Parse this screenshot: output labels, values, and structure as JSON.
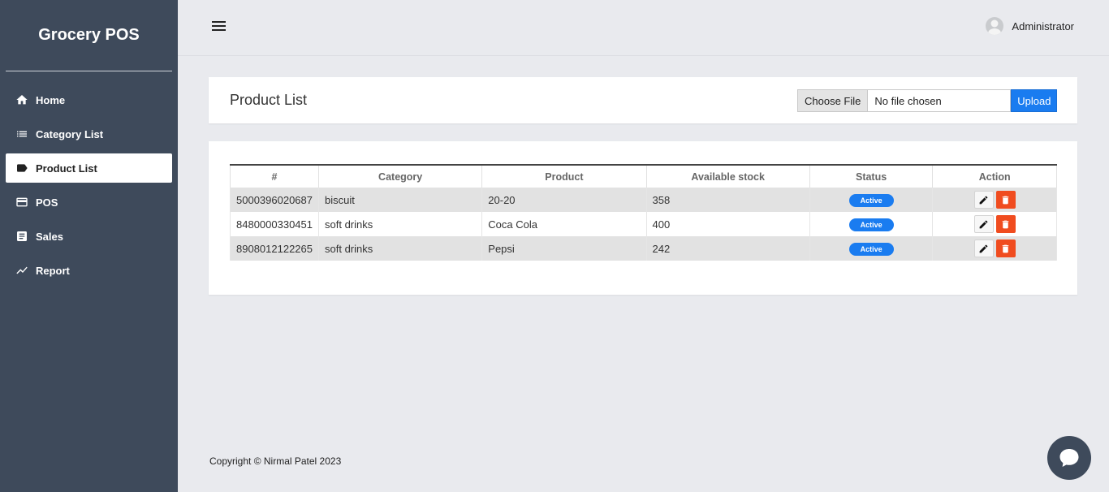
{
  "sidebar": {
    "brand": "Grocery POS",
    "items": [
      {
        "label": "Home",
        "icon": "home-icon"
      },
      {
        "label": "Category List",
        "icon": "list-icon"
      },
      {
        "label": "Product List",
        "icon": "tag-icon",
        "active": true
      },
      {
        "label": "POS",
        "icon": "card-icon"
      },
      {
        "label": "Sales",
        "icon": "receipt-icon"
      },
      {
        "label": "Report",
        "icon": "trending-icon"
      }
    ]
  },
  "header": {
    "menu_icon": "hamburger-icon",
    "user_name": "Administrator"
  },
  "main": {
    "title": "Product List",
    "file_input": {
      "button_label": "Choose File",
      "status": "No file chosen"
    },
    "upload_label": "Upload",
    "table": {
      "columns": [
        "#",
        "Category",
        "Product",
        "Available stock",
        "Status",
        "Action"
      ],
      "rows": [
        {
          "id": "5000396020687",
          "category": "biscuit",
          "product": "20-20",
          "stock": "358",
          "status": "Active"
        },
        {
          "id": "8480000330451",
          "category": "soft drinks",
          "product": "Coca Cola",
          "stock": "400",
          "status": "Active"
        },
        {
          "id": "8908012122265",
          "category": "soft drinks",
          "product": "Pepsi",
          "stock": "242",
          "status": "Active"
        }
      ]
    }
  },
  "footer": {
    "copyright": "Copyright © Nirmal Patel 2023"
  },
  "colors": {
    "sidebar_bg": "#3e4a5b",
    "accent_blue": "#1a7cf0",
    "delete_red": "#f04c1f"
  }
}
